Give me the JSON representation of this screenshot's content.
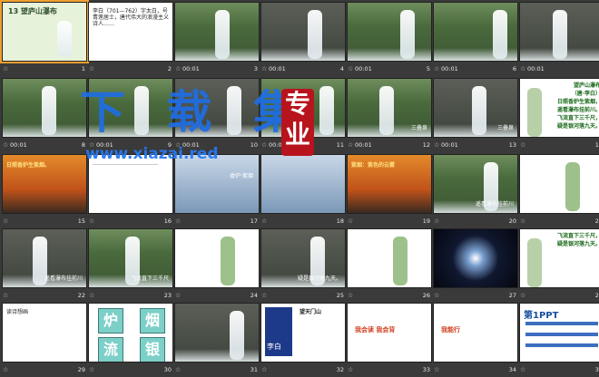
{
  "watermark": {
    "main": "下 载 集",
    "url": "www.xiazai.red",
    "seal": "专业"
  },
  "slides": [
    {
      "n": "1",
      "time": "",
      "title": "13 望庐山瀑布",
      "kind": "title"
    },
    {
      "n": "2",
      "time": "",
      "kind": "doc",
      "text": "李白（701—762）字太白，号青莲居士，唐代伟大的浪漫主义诗人……"
    },
    {
      "n": "3",
      "time": "00:01",
      "kind": "fall"
    },
    {
      "n": "4",
      "time": "00:01",
      "kind": "fall"
    },
    {
      "n": "5",
      "time": "00:01",
      "kind": "fall"
    },
    {
      "n": "6",
      "time": "00:01",
      "kind": "fall"
    },
    {
      "n": "7",
      "time": "00:01",
      "kind": "fall"
    },
    {
      "n": "8",
      "time": "00:01",
      "kind": "fall"
    },
    {
      "n": "9",
      "time": "00:01",
      "kind": "fall"
    },
    {
      "n": "10",
      "time": "00:01",
      "kind": "fall"
    },
    {
      "n": "11",
      "time": "00:01",
      "kind": "fall"
    },
    {
      "n": "12",
      "time": "00:01",
      "kind": "fall",
      "label": "三叠泉"
    },
    {
      "n": "13",
      "time": "00:01",
      "kind": "fall",
      "label": "三叠泉"
    },
    {
      "n": "14",
      "time": "",
      "kind": "poem",
      "lines": [
        "望庐山瀑布",
        "（唐·李白）",
        "日照香炉生紫烟，",
        "遥看瀑布挂前川。",
        "飞流直下三千尺，",
        "疑是银河落九天。"
      ]
    },
    {
      "n": "15",
      "time": "",
      "kind": "sunset",
      "text": "日照香炉生紫烟。"
    },
    {
      "n": "16",
      "time": "",
      "kind": "doc2"
    },
    {
      "n": "17",
      "time": "",
      "kind": "clouds",
      "label": "香炉·紫烟"
    },
    {
      "n": "18",
      "time": "",
      "kind": "clouds"
    },
    {
      "n": "19",
      "time": "",
      "kind": "sunset2",
      "label": "紫烟：紫色的云雾"
    },
    {
      "n": "20",
      "time": "",
      "kind": "fall",
      "label": "遥看瀑布挂前川"
    },
    {
      "n": "21",
      "time": "",
      "kind": "fallnote"
    },
    {
      "n": "22",
      "time": "",
      "kind": "fall",
      "label": "遥看瀑布挂前川"
    },
    {
      "n": "23",
      "time": "",
      "kind": "fall",
      "label": "飞流直下三千尺"
    },
    {
      "n": "24",
      "time": "",
      "kind": "fallnote2"
    },
    {
      "n": "25",
      "time": "",
      "kind": "fall",
      "label": "疑是银河落九天。"
    },
    {
      "n": "26",
      "time": "",
      "kind": "fallnote3"
    },
    {
      "n": "27",
      "time": "",
      "kind": "galaxy"
    },
    {
      "n": "28",
      "time": "",
      "kind": "poem2",
      "lines": [
        "飞流直下三千尺，",
        "疑是银河落九天。"
      ]
    },
    {
      "n": "29",
      "time": "",
      "kind": "doc3",
      "text": "读诗想画"
    },
    {
      "n": "30",
      "time": "",
      "kind": "chars",
      "chars": [
        "炉",
        "烟",
        "流",
        "银"
      ]
    },
    {
      "n": "31",
      "time": "",
      "kind": "fall"
    },
    {
      "n": "32",
      "time": "",
      "kind": "libai",
      "label": "李白",
      "title": "望天门山"
    },
    {
      "n": "33",
      "time": "",
      "kind": "cartoon",
      "text": "我会读  我会背"
    },
    {
      "n": "34",
      "time": "",
      "kind": "cartoon2",
      "text": "我能行"
    },
    {
      "n": "35",
      "time": "",
      "kind": "ppt",
      "logo": "第1PPT"
    }
  ]
}
